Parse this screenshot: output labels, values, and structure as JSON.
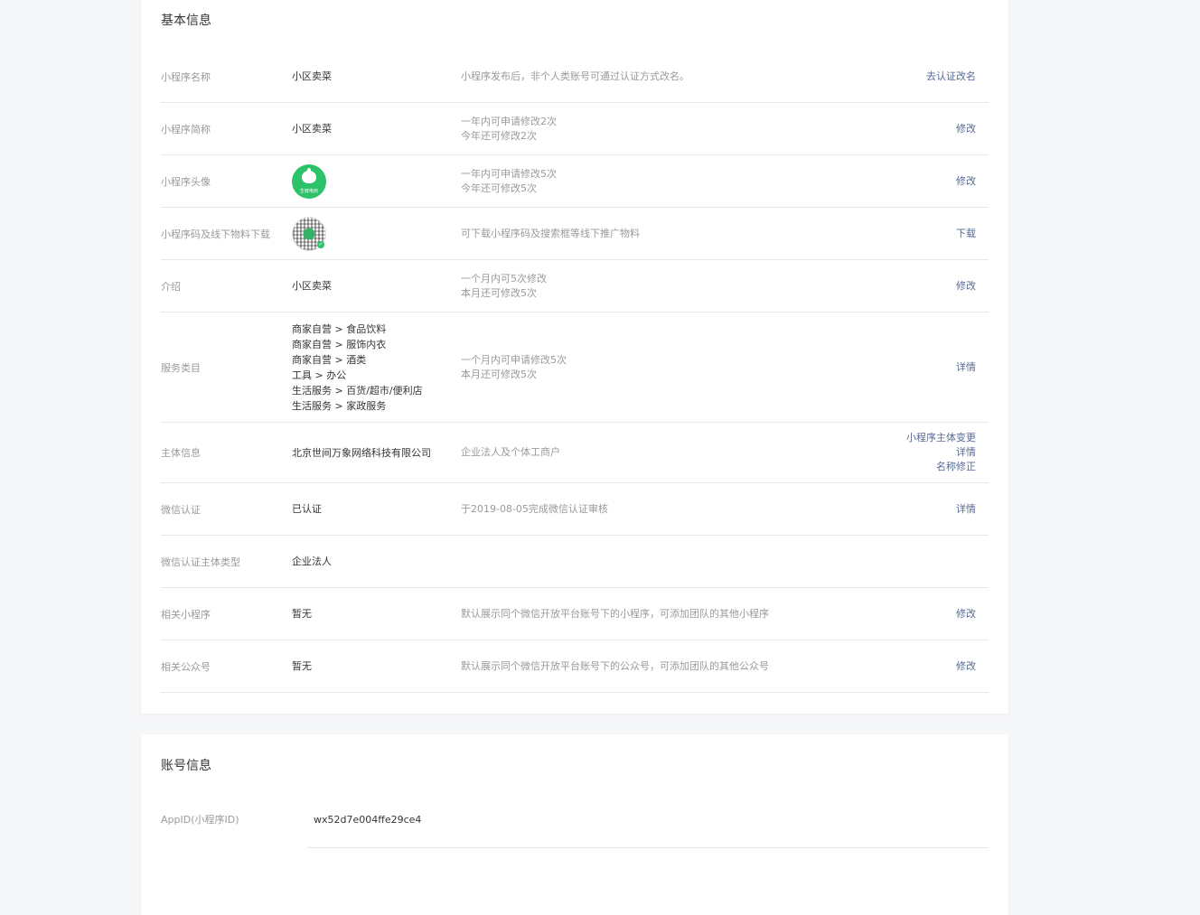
{
  "basic_info": {
    "title": "基本信息",
    "rows": [
      {
        "label": "小程序名称",
        "value": "小区卖菜",
        "desc": [
          "小程序发布后，非个人类账号可通过认证方式改名。"
        ],
        "actions": [
          "去认证改名"
        ]
      },
      {
        "label": "小程序简称",
        "value": "小区卖菜",
        "desc": [
          "一年内可申请修改2次",
          "今年还可修改2次"
        ],
        "actions": [
          "修改"
        ]
      },
      {
        "label": "小程序头像",
        "avatar_icon": "app-avatar-icon",
        "avatar_text": "生鲜电商",
        "desc": [
          "一年内可申请修改5次",
          "今年还可修改5次"
        ],
        "actions": [
          "修改"
        ]
      },
      {
        "label": "小程序码及线下物料下载",
        "qrcode_icon": "mini-program-code-icon",
        "desc": [
          "可下载小程序码及搜索框等线下推广物料"
        ],
        "actions": [
          "下载"
        ]
      },
      {
        "label": "介绍",
        "value": "小区卖菜",
        "desc": [
          "一个月内可5次修改",
          "本月还可修改5次"
        ],
        "actions": [
          "修改"
        ]
      },
      {
        "label": "服务类目",
        "categories": [
          "商家自营 > 食品饮料",
          "商家自营 > 服饰内衣",
          "商家自营 > 酒类",
          "工具 > 办公",
          "生活服务 > 百货/超市/便利店",
          "生活服务 > 家政服务"
        ],
        "desc": [
          "一个月内可申请修改5次",
          "本月还可修改5次"
        ],
        "actions": [
          "详情"
        ]
      },
      {
        "label": "主体信息",
        "value": "北京世间万象网络科技有限公司",
        "desc": [
          "企业法人及个体工商户"
        ],
        "actions": [
          "小程序主体变更",
          "详情",
          "名称修正"
        ]
      },
      {
        "label": "微信认证",
        "value": "已认证",
        "desc": [
          "于2019-08-05完成微信认证审核"
        ],
        "actions": [
          "详情"
        ]
      },
      {
        "label": "微信认证主体类型",
        "value": "企业法人",
        "desc": [],
        "actions": []
      },
      {
        "label": "相关小程序",
        "value": "暂无",
        "desc": [
          "默认展示同个微信开放平台账号下的小程序，可添加团队的其他小程序"
        ],
        "actions": [
          "修改"
        ]
      },
      {
        "label": "相关公众号",
        "value": "暂无",
        "desc": [
          "默认展示同个微信开放平台账号下的公众号，可添加团队的其他公众号"
        ],
        "actions": [
          "修改"
        ]
      }
    ]
  },
  "account_info": {
    "title": "账号信息",
    "rows": [
      {
        "label": "AppID(小程序ID)",
        "value": "wx52d7e004ffe29ce4"
      }
    ]
  },
  "colors": {
    "page_bg": "#f6f7f9",
    "card_bg": "#ffffff",
    "link": "#576b95",
    "muted_text": "#9a9a9a",
    "primary_text": "#353535",
    "divider": "#e7e7eb",
    "avatar_green": "#2bc26a"
  }
}
